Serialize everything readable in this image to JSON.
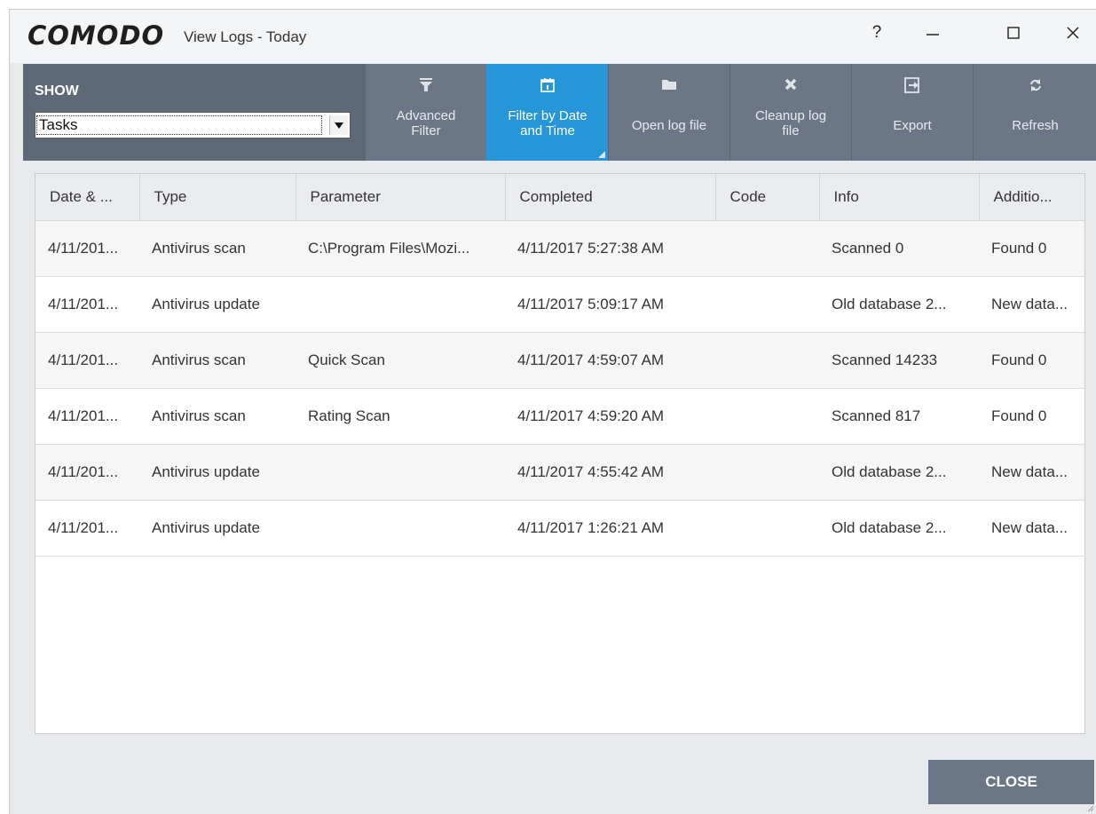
{
  "window": {
    "brand": "COMODO",
    "title": "View Logs - Today",
    "controls": {
      "help": "?",
      "minimize": "—",
      "maximize": "☐",
      "close": "✕"
    }
  },
  "toolbar": {
    "show_label": "SHOW",
    "show_value": "Tasks",
    "buttons": [
      {
        "line1": "Advanced",
        "line2": "Filter",
        "icon": "filter-icon"
      },
      {
        "line1": "Filter by Date",
        "line2": "and Time",
        "icon": "calendar-icon",
        "active": true
      },
      {
        "line1": "Open log file",
        "line2": "",
        "icon": "folder-icon"
      },
      {
        "line1": "Cleanup log",
        "line2": "file",
        "icon": "cleanup-x-icon"
      },
      {
        "line1": "Export",
        "line2": "",
        "icon": "export-icon"
      },
      {
        "line1": "Refresh",
        "line2": "",
        "icon": "refresh-icon"
      }
    ]
  },
  "table": {
    "columns": [
      "Date & ...",
      "Type",
      "Parameter",
      "Completed",
      "Code",
      "Info",
      "Additio..."
    ],
    "rows": [
      [
        "4/11/201...",
        "Antivirus scan",
        "C:\\Program Files\\Mozi...",
        "4/11/2017 5:27:38 AM",
        "",
        "Scanned 0",
        "Found 0"
      ],
      [
        "4/11/201...",
        "Antivirus update",
        "",
        "4/11/2017 5:09:17 AM",
        "",
        "Old database 2...",
        "New data..."
      ],
      [
        "4/11/201...",
        "Antivirus scan",
        "Quick Scan",
        "4/11/2017 4:59:07 AM",
        "",
        "Scanned 14233",
        "Found 0"
      ],
      [
        "4/11/201...",
        "Antivirus scan",
        "Rating Scan",
        "4/11/2017 4:59:20 AM",
        "",
        "Scanned 817",
        "Found 0"
      ],
      [
        "4/11/201...",
        "Antivirus update",
        "",
        "4/11/2017 4:55:42 AM",
        "",
        "Old database 2...",
        "New data..."
      ],
      [
        "4/11/201...",
        "Antivirus update",
        "",
        "4/11/2017 1:26:21 AM",
        "",
        "Old database 2...",
        "New data..."
      ]
    ]
  },
  "footer": {
    "close_label": "CLOSE"
  },
  "colors": {
    "toolbar": "#6b7786",
    "show_panel": "#5d6977",
    "active": "#2696d8"
  }
}
